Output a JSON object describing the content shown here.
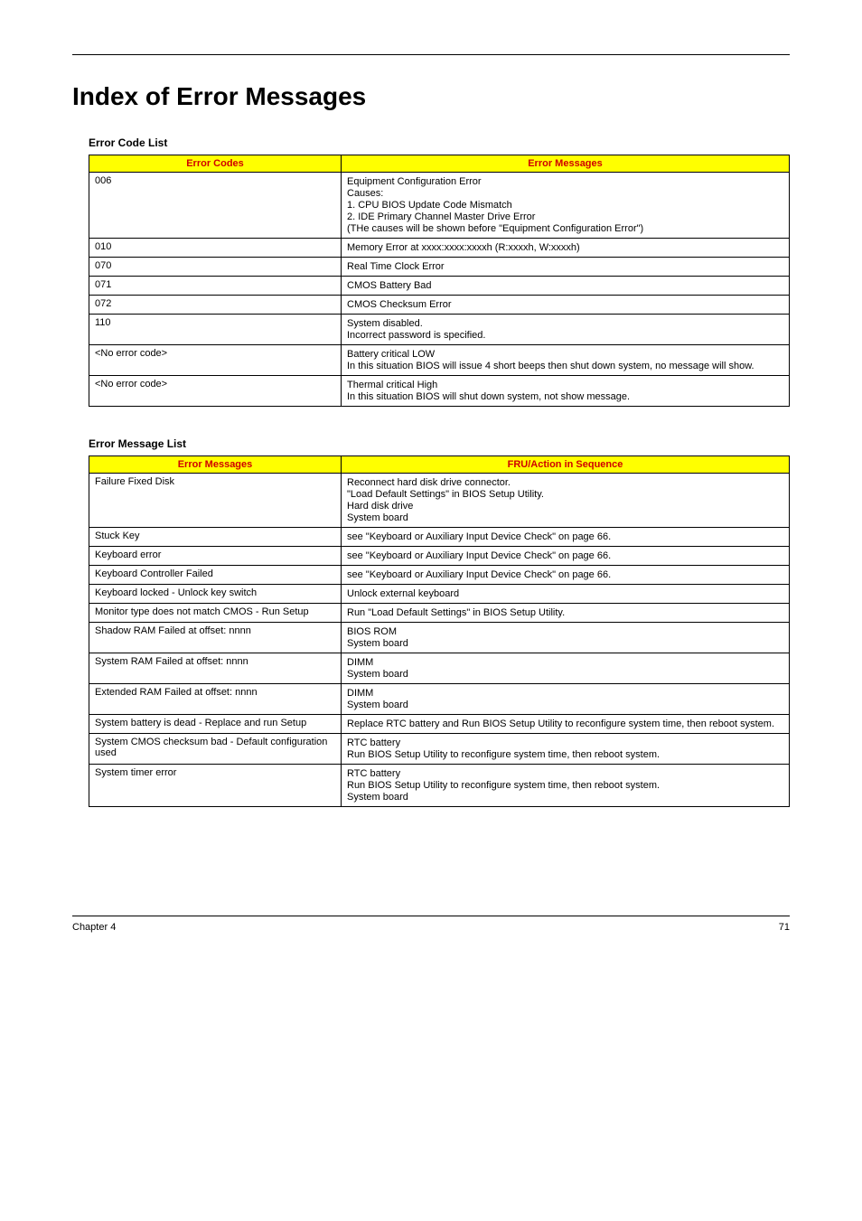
{
  "heading": "Index of Error Messages",
  "table1": {
    "title": "Error Code List",
    "headers": [
      "Error Codes",
      "Error Messages"
    ],
    "rows": [
      {
        "code": "006",
        "msg": [
          "Equipment Configuration Error",
          "Causes:",
          "1. CPU BIOS Update Code Mismatch",
          "2. IDE Primary Channel Master Drive Error",
          "(THe causes will be shown before \"Equipment Configuration Error\")"
        ]
      },
      {
        "code": "010",
        "msg": [
          "Memory Error at xxxx:xxxx:xxxxh (R:xxxxh, W:xxxxh)"
        ]
      },
      {
        "code": "070",
        "msg": [
          "Real Time Clock Error"
        ]
      },
      {
        "code": "071",
        "msg": [
          "CMOS Battery Bad"
        ]
      },
      {
        "code": "072",
        "msg": [
          "CMOS Checksum Error"
        ]
      },
      {
        "code": "110",
        "msg": [
          "System disabled.",
          "Incorrect password is specified."
        ]
      },
      {
        "code": "<No error code>",
        "msg": [
          "Battery critical LOW",
          "In this situation BIOS will issue 4 short beeps then shut down system, no message will show."
        ]
      },
      {
        "code": "<No error code>",
        "msg": [
          "Thermal critical High",
          "In this situation BIOS will shut down system, not show message."
        ]
      }
    ]
  },
  "table2": {
    "title": "Error Message List",
    "headers": [
      "Error Messages",
      "FRU/Action in Sequence"
    ],
    "rows": [
      {
        "code": "Failure Fixed Disk",
        "msg": [
          "Reconnect hard disk drive connector.",
          "\"Load Default Settings\" in BIOS Setup Utility.",
          "Hard disk drive",
          "System board"
        ]
      },
      {
        "code": "Stuck Key",
        "msg": [
          "see \"Keyboard or Auxiliary Input Device Check\" on page 66."
        ]
      },
      {
        "code": "Keyboard error",
        "msg": [
          "see \"Keyboard or Auxiliary Input Device Check\" on page 66."
        ]
      },
      {
        "code": "Keyboard Controller Failed",
        "msg": [
          "see \"Keyboard or Auxiliary Input Device Check\" on page 66."
        ]
      },
      {
        "code": "Keyboard locked - Unlock key switch",
        "msg": [
          "Unlock external keyboard"
        ]
      },
      {
        "code": "Monitor type does not match CMOS - Run Setup",
        "msg": [
          "Run \"Load Default Settings\" in BIOS Setup Utility."
        ]
      },
      {
        "code": "Shadow RAM Failed at offset: nnnn",
        "msg": [
          "BIOS ROM",
          "System board"
        ]
      },
      {
        "code": "System RAM Failed at offset: nnnn",
        "msg": [
          "DIMM",
          "System board"
        ]
      },
      {
        "code": "Extended RAM Failed at offset: nnnn",
        "msg": [
          "DIMM",
          "System board"
        ]
      },
      {
        "code": "System battery is dead - Replace and run Setup",
        "msg": [
          "Replace RTC battery and Run BIOS Setup Utility to reconfigure system time, then reboot system."
        ]
      },
      {
        "code": "System CMOS checksum bad - Default configuration used",
        "msg": [
          "RTC battery",
          "Run BIOS Setup Utility to reconfigure system time, then reboot system."
        ]
      },
      {
        "code": "System timer error",
        "msg": [
          "RTC battery",
          "Run BIOS Setup Utility to reconfigure system time, then reboot system.",
          "System board"
        ]
      }
    ]
  },
  "footer": {
    "left": "Chapter 4",
    "right": "71"
  }
}
